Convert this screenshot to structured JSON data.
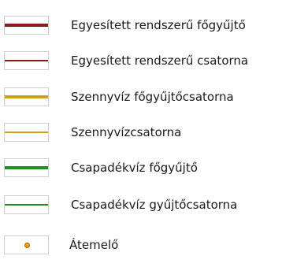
{
  "legend": {
    "items": [
      {
        "label": "Egyesített rendszerű főgyűjtő",
        "color": "#8b1a1a",
        "symbol": "line",
        "weight": "thick",
        "icon": "line-symbol-icon"
      },
      {
        "label": "Egyesített rendszerű csatorna",
        "color": "#8b1a1a",
        "symbol": "line",
        "weight": "thin",
        "icon": "line-symbol-icon"
      },
      {
        "label": "Szennyvíz főgyűjtőcsatorna",
        "color": "#d4a017",
        "symbol": "line",
        "weight": "thick",
        "icon": "line-symbol-icon"
      },
      {
        "label": "Szennyvízcsatorna",
        "color": "#d4a017",
        "symbol": "line",
        "weight": "thin",
        "icon": "line-symbol-icon"
      },
      {
        "label": "Csapadékvíz főgyűjtő",
        "color": "#1e8c1e",
        "symbol": "line",
        "weight": "thick",
        "icon": "line-symbol-icon"
      },
      {
        "label": "Csapadékvíz gyűjtőcsatorna",
        "color": "#1e8c1e",
        "symbol": "line",
        "weight": "thin",
        "icon": "line-symbol-icon"
      },
      {
        "label": "Átemelő",
        "color": "#e3a21a",
        "symbol": "point",
        "weight": "thin",
        "icon": "pumping-station-dot-icon"
      }
    ]
  }
}
